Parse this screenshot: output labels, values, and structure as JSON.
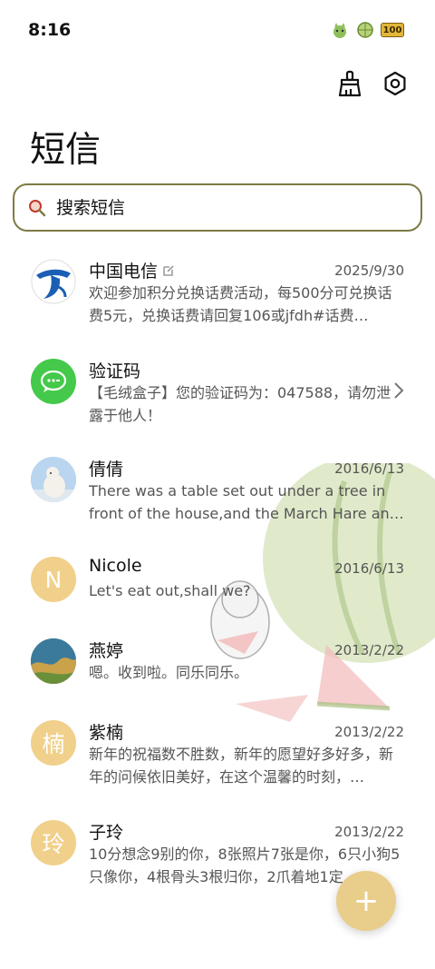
{
  "status": {
    "time": "8:16",
    "battery": "100"
  },
  "header": {
    "title": "短信"
  },
  "search": {
    "placeholder": "搜索短信"
  },
  "messages": [
    {
      "name": "中国电信",
      "date": "2025/9/30",
      "preview": "欢迎参加积分兑换话费活动，每500分可兑换话费5元，兑换话费请回复106或jfdh#话费…",
      "avatar": "china-telecom-logo"
    },
    {
      "name": "验证码",
      "date": "",
      "preview": "【毛绒盒子】您的验证码为：047588，请勿泄露于他人！",
      "avatar": "message-bubble"
    },
    {
      "name": "倩倩",
      "date": "2016/6/13",
      "preview": "There was a table set out under a tree in front of the house,and the March Hare an…",
      "avatar": "polar-bear-photo"
    },
    {
      "name": "Nicole",
      "date": "2016/6/13",
      "preview": "Let's eat out,shall we?",
      "avatar_letter": "N"
    },
    {
      "name": "燕婷",
      "date": "2013/2/22",
      "preview": "嗯。收到啦。同乐同乐。",
      "avatar": "landscape-photo"
    },
    {
      "name": "紫楠",
      "date": "2013/2/22",
      "preview": "新年的祝福数不胜数，新年的愿望好多好多，新年的问候依旧美好，在这个温馨的时刻，…",
      "avatar_letter": "楠"
    },
    {
      "name": "子玲",
      "date": "2013/2/22",
      "preview": "10分想念9别的你，8张照片7张是你，6只小狗5只像你，4根骨头3根归你，2爪着地1定…",
      "avatar_letter": "玲"
    }
  ],
  "fab": {
    "label": "+"
  },
  "colors": {
    "accent": "#e9cd8a",
    "search_border": "#7d7a45",
    "avatar_letter_bg": "#f0d08a"
  }
}
